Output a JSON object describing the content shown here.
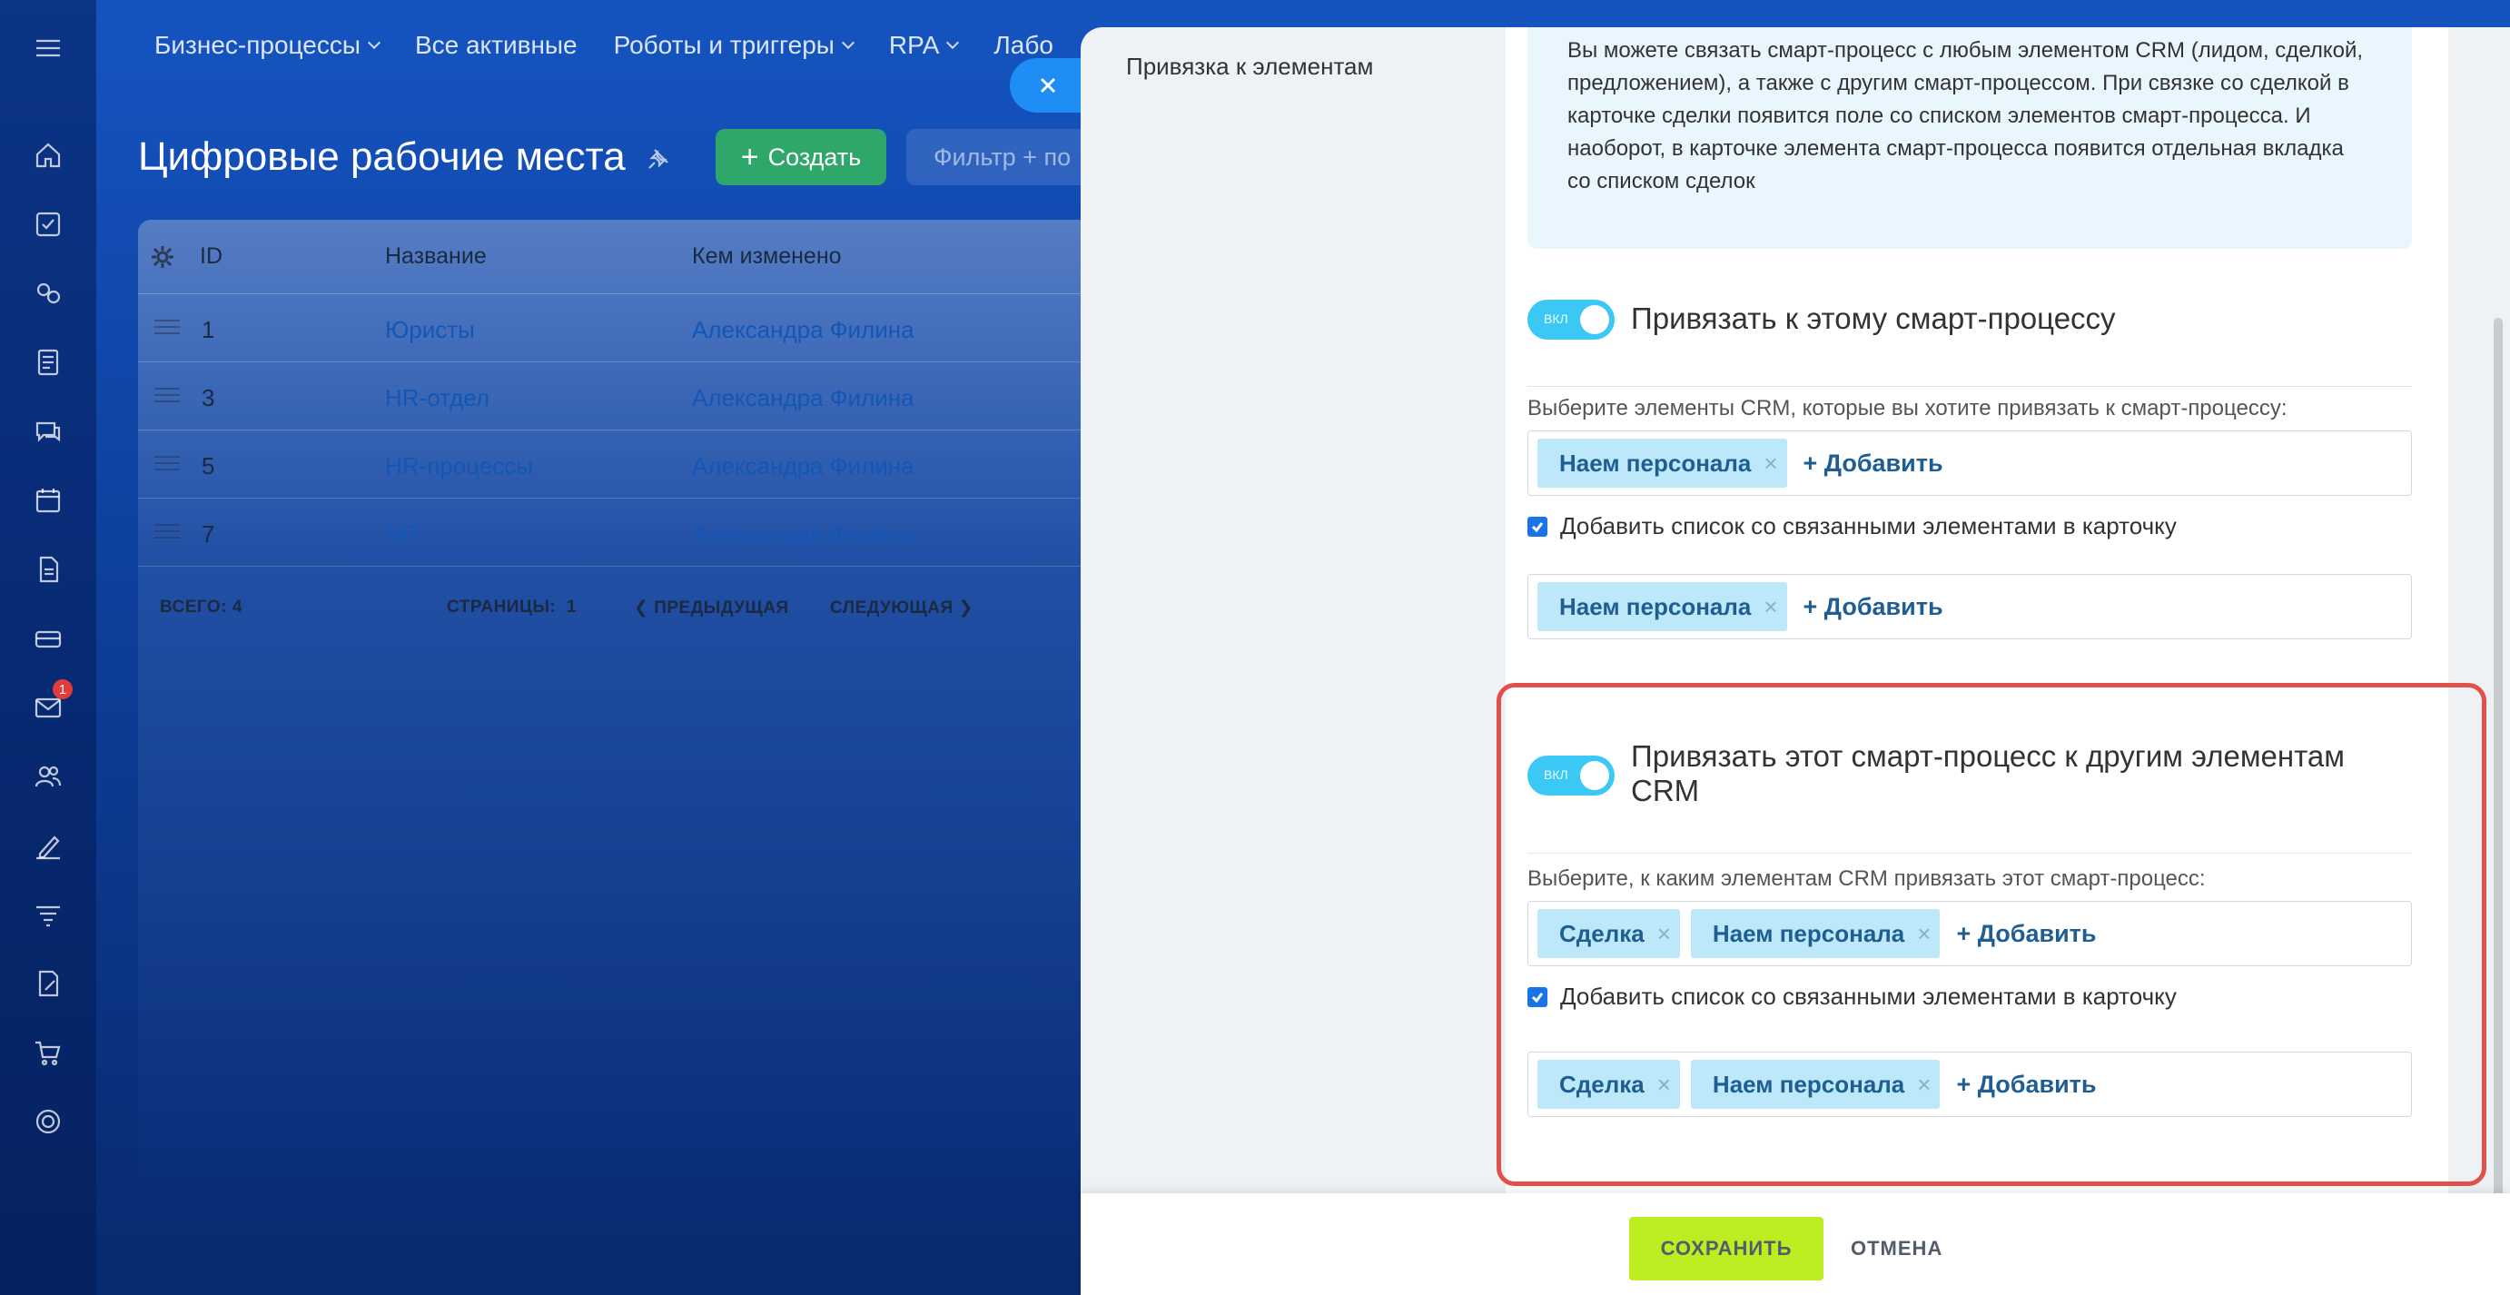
{
  "topnav": {
    "items": [
      "Бизнес-процессы",
      "Все активные",
      "Роботы и триггеры",
      "RPA",
      "Лабо"
    ]
  },
  "page": {
    "title": "Цифровые рабочие места",
    "create_label": "Создать",
    "filter_placeholder": "Фильтр + по"
  },
  "grid": {
    "columns": [
      "ID",
      "Название",
      "Кем изменено"
    ],
    "rows": [
      {
        "id": "1",
        "name": "Юристы",
        "modified_by": "Александра Филина"
      },
      {
        "id": "3",
        "name": "HR-отдел",
        "modified_by": "Александра Филина"
      },
      {
        "id": "5",
        "name": "HR-процессы",
        "modified_by": "Александра Филина"
      },
      {
        "id": "7",
        "name": "HR",
        "modified_by": "Александра Филина"
      }
    ],
    "footer": {
      "total_label": "ВСЕГО:",
      "total_value": "4",
      "pages_label": "СТРАНИЦЫ:",
      "pages_value": "1",
      "prev_label": "ПРЕДЫДУЩАЯ",
      "next_label": "СЛЕДУЮЩАЯ"
    }
  },
  "rail": {
    "notification_count": "1"
  },
  "panel": {
    "side_label": "Привязка к элементам",
    "info_text": "Вы можете связать смарт-процесс с любым элементом CRM (лидом, сделкой, предложением), а также с другим смарт-процессом. При связке со сделкой в карточке сделки появится поле со списком элементов смарт-процесса. И наоборот, в карточке элемента смарт-процесса появится отдельная вкладка со списком сделок",
    "toggle_label": "ВКЛ",
    "section1": {
      "title": "Привязать к этому смарт-процессу",
      "hint": "Выберите элементы CRM, которые вы хотите привязать к смарт-процессу:",
      "tags_primary": [
        "Наем персонала"
      ],
      "checkbox_label": "Добавить список со связанными элементами в карточку",
      "tags_secondary": [
        "Наем персонала"
      ]
    },
    "section2": {
      "title": "Привязать этот смарт-процесс к другим элементам CRM",
      "hint": "Выберите, к каким элементам CRM привязать этот смарт-процесс:",
      "tags_primary": [
        "Сделка",
        "Наем персонала"
      ],
      "checkbox_label": "Добавить список со связанными элементами в карточку",
      "tags_secondary": [
        "Сделка",
        "Наем персонала"
      ]
    },
    "add_label": "+ Добавить",
    "remove_glyph": "×"
  },
  "footer": {
    "save_label": "СОХРАНИТЬ",
    "cancel_label": "ОТМЕНА"
  },
  "colors": {
    "accent_toggle": "#3bc8f5",
    "save_button": "#bbed21",
    "highlight_border": "#e2504c",
    "tag_background": "#bce8f9"
  }
}
